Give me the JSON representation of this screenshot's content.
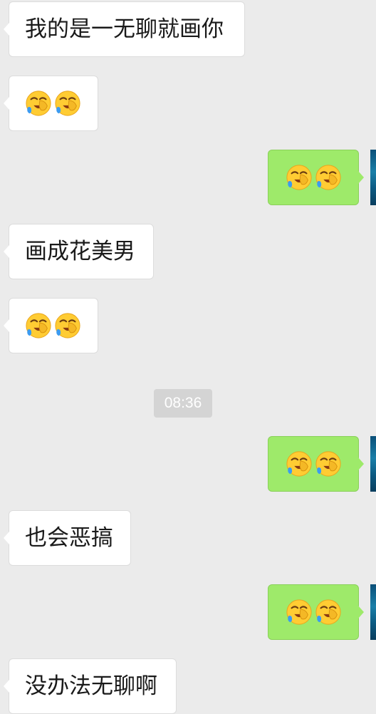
{
  "messages": [
    {
      "side": "left",
      "kind": "text",
      "text": "我的是一无聊就画你"
    },
    {
      "side": "left",
      "kind": "emoji",
      "emoji": "face-palm-crying-emoji",
      "count": 2
    },
    {
      "side": "right",
      "kind": "emoji",
      "emoji": "face-palm-crying-emoji",
      "count": 2
    },
    {
      "side": "left",
      "kind": "text",
      "text": "画成花美男"
    },
    {
      "side": "left",
      "kind": "emoji",
      "emoji": "face-palm-crying-emoji",
      "count": 2
    },
    {
      "side": "right",
      "kind": "emoji",
      "emoji": "face-palm-crying-emoji",
      "count": 2
    },
    {
      "side": "left",
      "kind": "text",
      "text": "也会恶搞"
    },
    {
      "side": "right",
      "kind": "emoji",
      "emoji": "face-palm-crying-emoji",
      "count": 2
    },
    {
      "side": "left",
      "kind": "text",
      "text": "没办法无聊啊"
    }
  ],
  "timestamp": "08:36",
  "colors": {
    "background": "#ebebeb",
    "incoming_bubble": "#ffffff",
    "outgoing_bubble": "#9eea6a",
    "timestamp_bg": "#d4d4d4"
  }
}
